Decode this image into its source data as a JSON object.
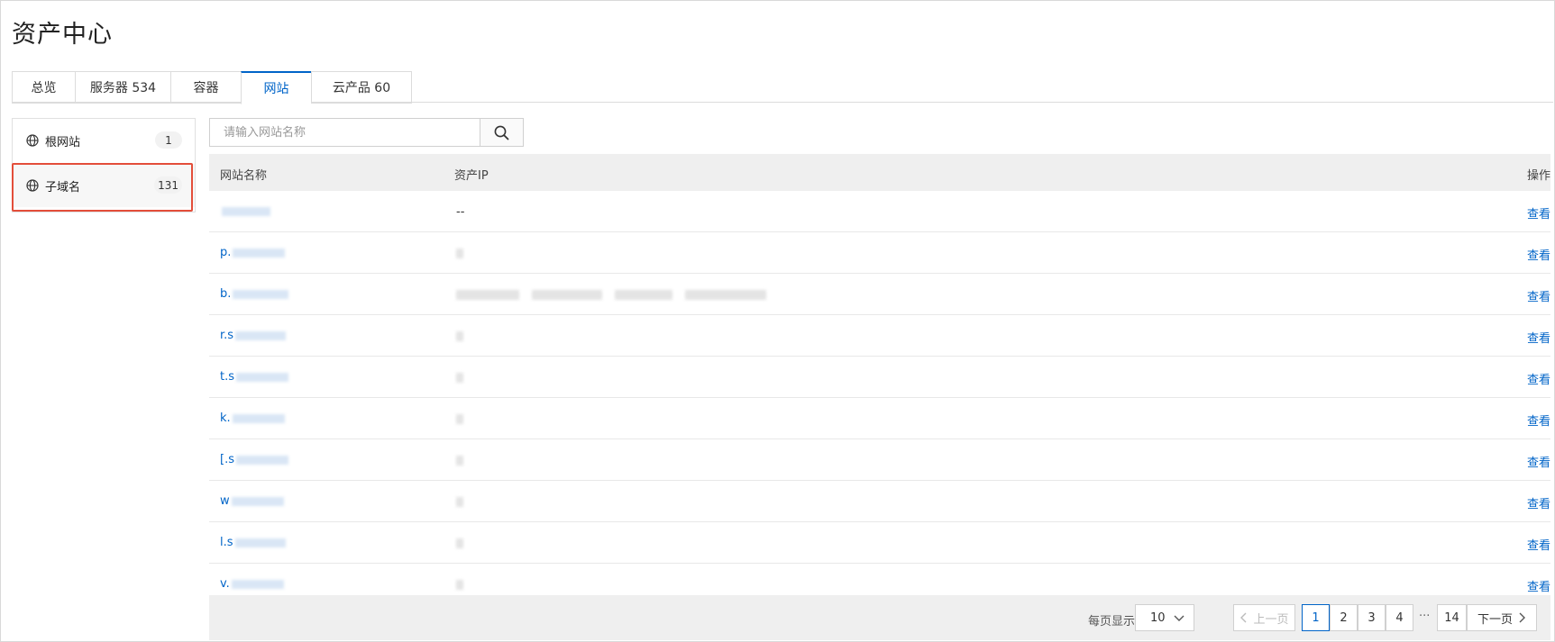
{
  "page": {
    "title": "资产中心"
  },
  "tabs": [
    {
      "label": "总览"
    },
    {
      "label": "服务器 534"
    },
    {
      "label": "容器"
    },
    {
      "label": "网站",
      "active": true
    },
    {
      "label": "云产品 60"
    }
  ],
  "sidebar": {
    "items": [
      {
        "label": "根网站",
        "count": "1"
      },
      {
        "label": "子域名",
        "count": "131",
        "selected": true
      }
    ]
  },
  "search": {
    "placeholder": "请输入网站名称",
    "value": ""
  },
  "table": {
    "columns": {
      "name": "网站名称",
      "ip": "资产IP",
      "action": "操作"
    },
    "rows": [
      {
        "name": "",
        "ip": "--",
        "action": "查看"
      },
      {
        "name": "p.",
        "ip": "",
        "action": "查看"
      },
      {
        "name": "b.",
        "ip": "",
        "action": "查看"
      },
      {
        "name": "r.s",
        "ip": "",
        "action": "查看"
      },
      {
        "name": "t.s",
        "ip": "",
        "action": "查看"
      },
      {
        "name": "k.",
        "ip": "",
        "action": "查看"
      },
      {
        "name": "[.s",
        "ip": "",
        "action": "查看"
      },
      {
        "name": "w",
        "ip": "",
        "action": "查看"
      },
      {
        "name": "l.s",
        "ip": "",
        "action": "查看"
      },
      {
        "name": "v.",
        "ip": "",
        "action": "查看"
      }
    ]
  },
  "pagination": {
    "page_size_label": "每页显示",
    "page_size": "10",
    "prev": "上一页",
    "next": "下一页",
    "pages": [
      "1",
      "2",
      "3",
      "4"
    ],
    "ellipsis": "···",
    "last": "14",
    "current": "1"
  },
  "colors": {
    "accent": "#0064c8",
    "highlight": "#e34e3a"
  }
}
